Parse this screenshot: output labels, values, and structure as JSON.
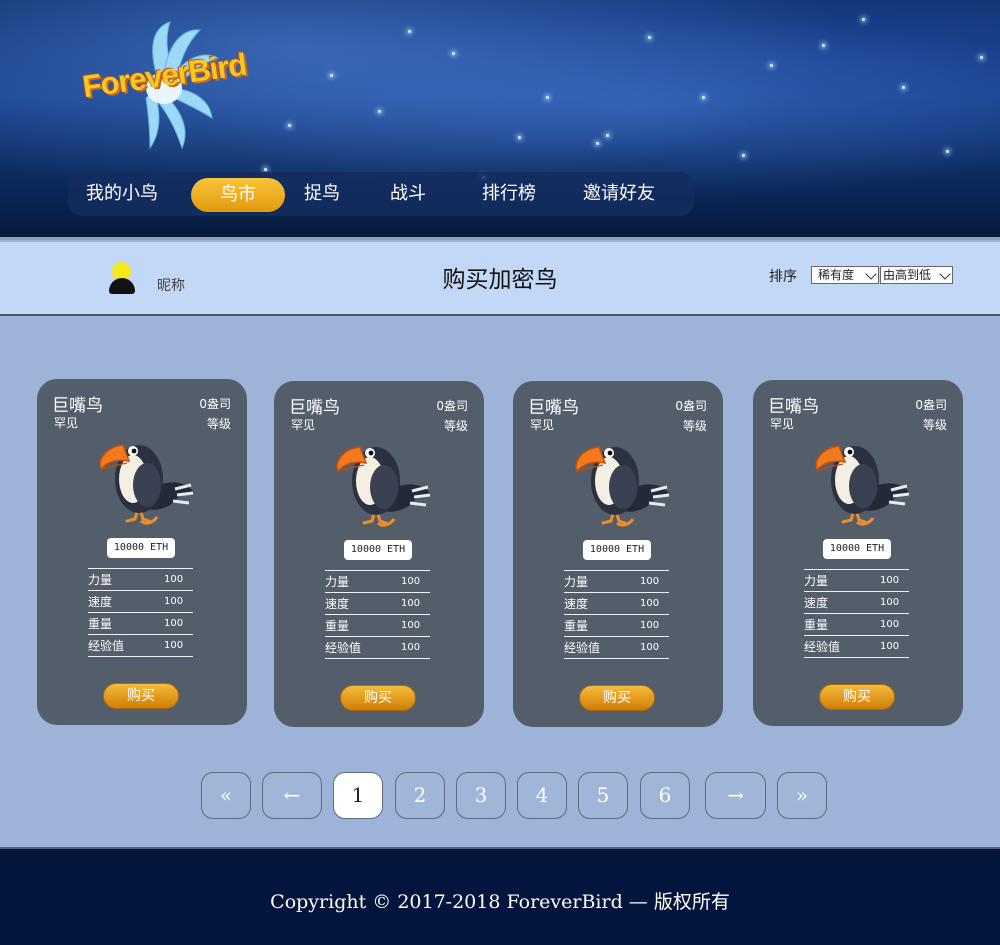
{
  "header": {
    "logo_text": "ForeverBird",
    "nav": [
      {
        "label": "我的小鸟",
        "active": false
      },
      {
        "label": "鸟市",
        "active": true
      },
      {
        "label": "捉鸟",
        "active": false
      },
      {
        "label": "战斗",
        "active": false
      },
      {
        "label": "排行榜",
        "active": false
      },
      {
        "label": "邀请好友",
        "active": false
      }
    ]
  },
  "subbar": {
    "nickname": "昵称",
    "title": "购买加密鸟",
    "sort_label": "排序",
    "sort_by": "稀有度",
    "sort_order": "由高到低"
  },
  "cards": [
    {
      "name": "巨嘴鸟",
      "generation": "0盎司",
      "rarity": "罕见",
      "level": "等级",
      "price": "10000 ETH",
      "stats": [
        {
          "label": "力量",
          "value": "100"
        },
        {
          "label": "速度",
          "value": "100"
        },
        {
          "label": "重量",
          "value": "100"
        },
        {
          "label": "经验值",
          "value": "100"
        }
      ],
      "buy_label": "购买"
    },
    {
      "name": "巨嘴鸟",
      "generation": "0盎司",
      "rarity": "罕见",
      "level": "等级",
      "price": "10000 ETH",
      "stats": [
        {
          "label": "力量",
          "value": "100"
        },
        {
          "label": "速度",
          "value": "100"
        },
        {
          "label": "重量",
          "value": "100"
        },
        {
          "label": "经验值",
          "value": "100"
        }
      ],
      "buy_label": "购买"
    },
    {
      "name": "巨嘴鸟",
      "generation": "0盎司",
      "rarity": "罕见",
      "level": "等级",
      "price": "10000 ETH",
      "stats": [
        {
          "label": "力量",
          "value": "100"
        },
        {
          "label": "速度",
          "value": "100"
        },
        {
          "label": "重量",
          "value": "100"
        },
        {
          "label": "经验值",
          "value": "100"
        }
      ],
      "buy_label": "购买"
    },
    {
      "name": "巨嘴鸟",
      "generation": "0盎司",
      "rarity": "罕见",
      "level": "等级",
      "price": "10000 ETH",
      "stats": [
        {
          "label": "力量",
          "value": "100"
        },
        {
          "label": "速度",
          "value": "100"
        },
        {
          "label": "重量",
          "value": "100"
        },
        {
          "label": "经验值",
          "value": "100"
        }
      ],
      "buy_label": "购买"
    }
  ],
  "pagination": {
    "first": "«",
    "prev": "←",
    "pages": [
      "1",
      "2",
      "3",
      "4",
      "5",
      "6"
    ],
    "current": "1",
    "next": "→",
    "last": "»"
  },
  "footer": {
    "copyright": "Copyright © 2017-2018 ForeverBird — 版权所有"
  },
  "colors": {
    "page_bg": "#9db3d7",
    "subbar_bg": "#c3d7f6",
    "card_bg": "#545e6b",
    "accent_gold": "#f0a81f",
    "footer_bg": "#04153d"
  }
}
